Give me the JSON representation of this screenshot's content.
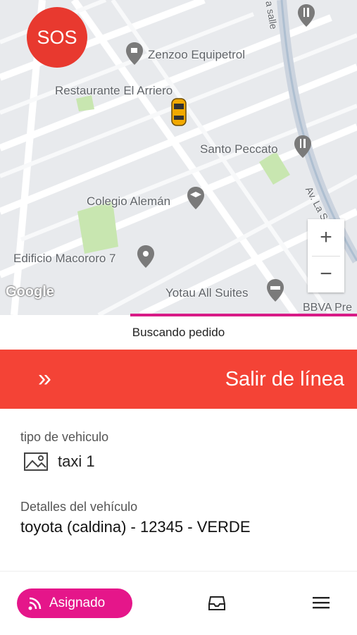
{
  "map": {
    "pois": [
      {
        "name": "Zenzoo Equipetrol",
        "icon": "cafe-icon"
      },
      {
        "name": "Restaurante El Arriero",
        "icon": "none"
      },
      {
        "name": "Santo Peccato",
        "icon": "restaurant-icon"
      },
      {
        "name": "Colegio Alemán",
        "icon": "school-icon"
      },
      {
        "name": "Edificio Macororo 7",
        "icon": "place-icon"
      },
      {
        "name": "Yotau All Suites",
        "icon": "hotel-icon"
      },
      {
        "name": "BBVA Pre",
        "icon": "none"
      }
    ],
    "street_labels": [
      "Av. La Salle",
      "a salle"
    ],
    "attribution": "Google",
    "zoom_in_label": "+",
    "zoom_out_label": "−"
  },
  "sos_label": "SOS",
  "status_text": "Buscando pedido",
  "progress_fraction": 0.64,
  "offline_button": {
    "label": "Salir de línea",
    "chevron": "»"
  },
  "vehicle_type": {
    "label": "tipo de vehiculo",
    "value": "taxi 1",
    "icon": "image-icon"
  },
  "vehicle_details": {
    "label": "Detalles del vehículo",
    "value": "toyota (caldina) - 12345 - VERDE"
  },
  "bottom_bar": {
    "assigned_label": "Asignado",
    "inbox_icon": "inbox-icon",
    "menu_icon": "menu-icon"
  },
  "colors": {
    "accent": "#f44336",
    "pink": "#e5168a",
    "sos": "#e8392f"
  }
}
